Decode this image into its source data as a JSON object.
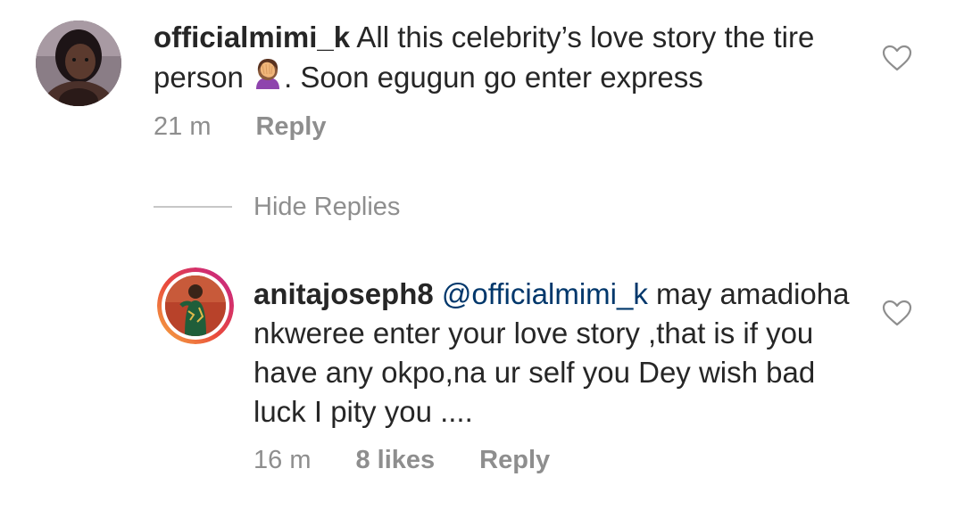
{
  "comment": {
    "username": "officialmimi_k",
    "text_before_emoji": " All this celebrity’s love story the tire person ",
    "emoji_icon": "facepalm-emoji",
    "text_after_emoji": ". Soon egugun go enter express",
    "time": "21 m",
    "reply_label": "Reply"
  },
  "replies_toggle": {
    "label": "Hide Replies"
  },
  "reply": {
    "username": "anitajoseph8",
    "mention": "@officialmimi_k",
    "text": " may amadioha nkweree enter your love story ,that is if you have any okpo,na ur self you Dey wish bad luck I pity you ....",
    "time": "16 m",
    "likes": "8 likes",
    "reply_label": "Reply"
  },
  "colors": {
    "text": "#262626",
    "muted": "#8e8e8e",
    "mention": "#00376b",
    "divider": "#c7c7c7"
  },
  "icons": {
    "like": "heart-outline-icon"
  }
}
